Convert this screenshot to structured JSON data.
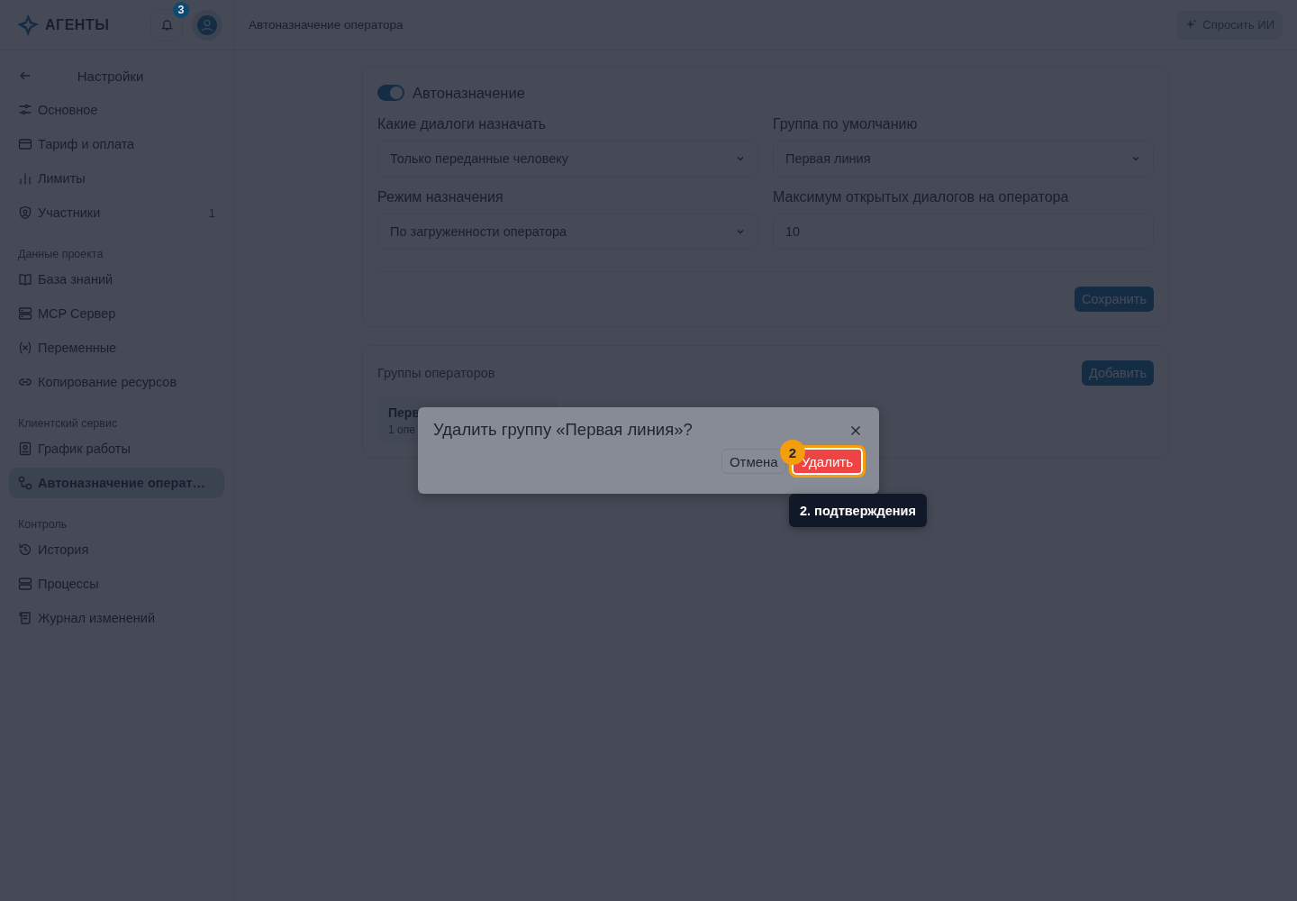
{
  "header": {
    "logo_text": "АГЕНТЫ",
    "notifications_count": "3",
    "page_title": "Автоназначение оператора",
    "ask_ai_button": "Спросить ИИ"
  },
  "sidebar": {
    "back_title": "Настройки",
    "sections": [
      {
        "items": [
          {
            "label": "Основное",
            "selected": false
          },
          {
            "label": "Тариф и оплата",
            "selected": false
          },
          {
            "label": "Лимиты",
            "selected": false
          },
          {
            "label": "Участники",
            "count": "1",
            "selected": false
          }
        ]
      },
      {
        "title": "Данные проекта",
        "items": [
          {
            "label": "База знаний",
            "selected": false
          },
          {
            "label": "MCP Сервер",
            "selected": false
          },
          {
            "label": "Переменные",
            "selected": false
          },
          {
            "label": "Копирование ресурсов",
            "selected": false
          }
        ]
      },
      {
        "title": "Клиентский сервис",
        "items": [
          {
            "label": "График работы",
            "selected": false
          },
          {
            "label": "Автоназначение операт…",
            "selected": true
          }
        ]
      },
      {
        "title": "Контроль",
        "items": [
          {
            "label": "История",
            "selected": false
          },
          {
            "label": "Процессы",
            "selected": false
          },
          {
            "label": "Журнал изменений",
            "selected": false
          }
        ]
      }
    ]
  },
  "settings": {
    "autoassign": {
      "label": "Автоназначение",
      "on": true
    },
    "fields": [
      {
        "label": "Какие диалоги назначать",
        "kind": "select",
        "value": "Только переданные человеку"
      },
      {
        "label": "Группа по умолчанию",
        "kind": "select",
        "value": "Первая линия"
      },
      {
        "label": "Режим назначения",
        "kind": "select",
        "value": "По загруженности оператора"
      },
      {
        "label": "Максимум открытых диалогов на оператора",
        "kind": "input",
        "value": "10"
      }
    ],
    "save_button": "Сохранить"
  },
  "groups": {
    "title": "Группы операторов",
    "add_button": "Добавить",
    "items": [
      {
        "name": "Перв",
        "meta": "1 опе"
      }
    ]
  },
  "dialog": {
    "title": "Удалить группу «Первая линия»?",
    "cancel_button": "Отмена",
    "confirm_button": "Удалить"
  },
  "tour": {
    "step": "2",
    "tooltip": "2. подтверждения"
  }
}
